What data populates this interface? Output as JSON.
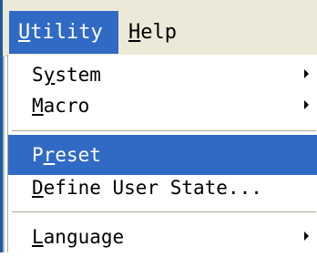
{
  "menubar": {
    "items": [
      {
        "label_first": "U",
        "label_rest": "tility",
        "active": true
      },
      {
        "label_first": "H",
        "label_rest": "elp",
        "active": false
      }
    ]
  },
  "dropdown": {
    "items": [
      {
        "label_a": "S",
        "label_b": "y",
        "label_c": "stem",
        "submenu": true
      },
      {
        "label_a": "",
        "label_b": "M",
        "label_c": "acro",
        "submenu": true
      },
      {
        "label_a": "P",
        "label_b": "r",
        "label_c": "eset",
        "submenu": false,
        "highlighted": true
      },
      {
        "label_a": "",
        "label_b": "D",
        "label_c": "efine User State...",
        "submenu": false
      },
      {
        "label_a": "",
        "label_b": "L",
        "label_c": "anguage",
        "submenu": true
      }
    ]
  },
  "colors": {
    "highlight": "#316ac5",
    "menubar_bg": "#ece9d8",
    "separator": "#aca899"
  }
}
